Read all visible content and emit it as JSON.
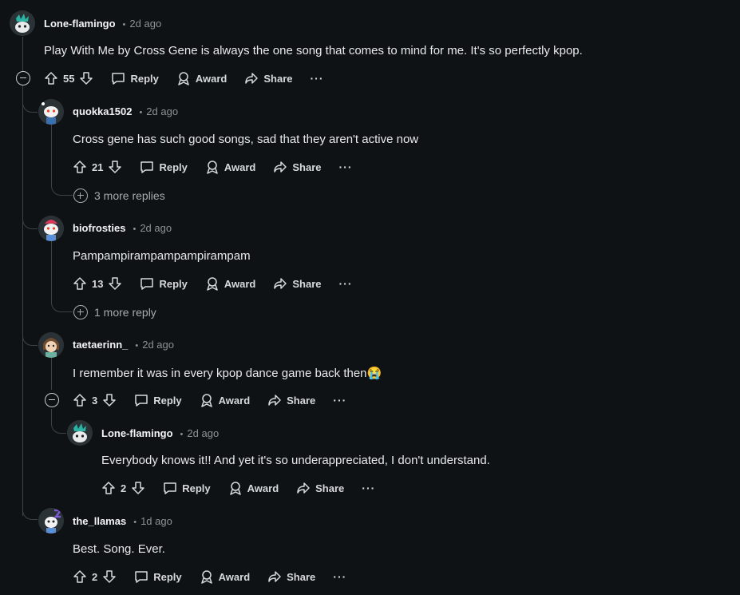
{
  "actions": {
    "reply": "Reply",
    "award": "Award",
    "share": "Share",
    "more": "···"
  },
  "comments": [
    {
      "user": "Lone-flamingo",
      "time": "2d ago",
      "text": "Play With Me by Cross Gene is always the one song that comes to mind for me. It's so perfectly kpop.",
      "votes": "55",
      "avatar_accent": "#2bb3a4"
    },
    {
      "user": "quokka1502",
      "time": "2d ago",
      "text": "Cross gene has such good songs, sad that they aren't active now",
      "votes": "21",
      "more_replies": "3 more replies",
      "avatar_accent": "#3a6fb0"
    },
    {
      "user": "biofrosties",
      "time": "2d ago",
      "text": "Pampampirampampampirampam",
      "votes": "13",
      "more_replies": "1 more reply",
      "avatar_accent": "#d63b5a"
    },
    {
      "user": "taetaerinn_",
      "time": "2d ago",
      "text": "I remember it was in every kpop dance game back then",
      "emoji": "😭",
      "votes": "3",
      "avatar_accent": "#6b4a2e"
    },
    {
      "user": "Lone-flamingo",
      "time": "2d ago",
      "text": "Everybody knows it!! And yet it's so underappreciated, I don't understand.",
      "votes": "2",
      "avatar_accent": "#2bb3a4"
    },
    {
      "user": "the_llamas",
      "time": "1d ago",
      "text": "Best. Song. Ever.",
      "votes": "2",
      "avatar_accent": "#7b5cd6"
    }
  ]
}
